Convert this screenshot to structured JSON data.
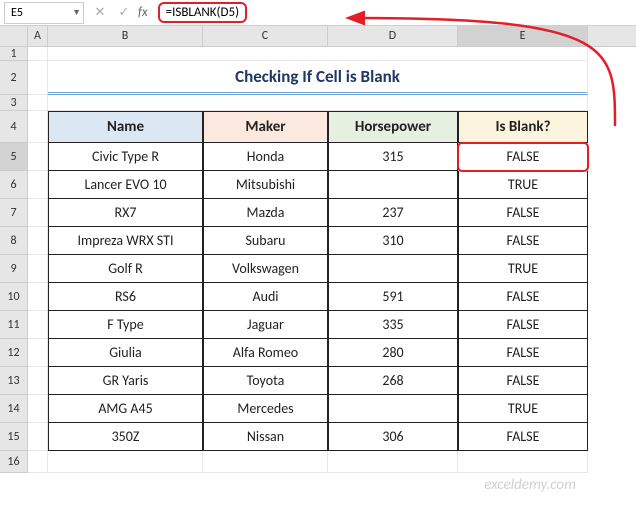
{
  "name_box": "E5",
  "formula": "=ISBLANK(D5)",
  "columns": [
    "A",
    "B",
    "C",
    "D",
    "E"
  ],
  "title": "Checking If Cell is Blank",
  "headers": {
    "name": "Name",
    "maker": "Maker",
    "hp": "Horsepower",
    "blank": "Is Blank?"
  },
  "rows": [
    {
      "n": "5",
      "name": "Civic Type R",
      "maker": "Honda",
      "hp": "315",
      "blank": "FALSE"
    },
    {
      "n": "6",
      "name": "Lancer EVO 10",
      "maker": "Mitsubishi",
      "hp": "",
      "blank": "TRUE"
    },
    {
      "n": "7",
      "name": "RX7",
      "maker": "Mazda",
      "hp": "237",
      "blank": "FALSE"
    },
    {
      "n": "8",
      "name": "Impreza WRX STI",
      "maker": "Subaru",
      "hp": "310",
      "blank": "FALSE"
    },
    {
      "n": "9",
      "name": "Golf R",
      "maker": "Volkswagen",
      "hp": "",
      "blank": "TRUE"
    },
    {
      "n": "10",
      "name": "RS6",
      "maker": "Audi",
      "hp": "591",
      "blank": "FALSE"
    },
    {
      "n": "11",
      "name": "F Type",
      "maker": "Jaguar",
      "hp": "335",
      "blank": "FALSE"
    },
    {
      "n": "12",
      "name": "Giulia",
      "maker": "Alfa Romeo",
      "hp": "280",
      "blank": "FALSE"
    },
    {
      "n": "13",
      "name": "GR Yaris",
      "maker": "Toyota",
      "hp": "268",
      "blank": "FALSE"
    },
    {
      "n": "14",
      "name": "AMG A45",
      "maker": "Mercedes",
      "hp": "",
      "blank": "TRUE"
    },
    {
      "n": "15",
      "name": "350Z",
      "maker": "Nissan",
      "hp": "306",
      "blank": "FALSE"
    }
  ],
  "row_labels_pre": [
    "1",
    "2",
    "3",
    "4"
  ],
  "row_label_post": "16",
  "watermark": "exceldemy.com"
}
